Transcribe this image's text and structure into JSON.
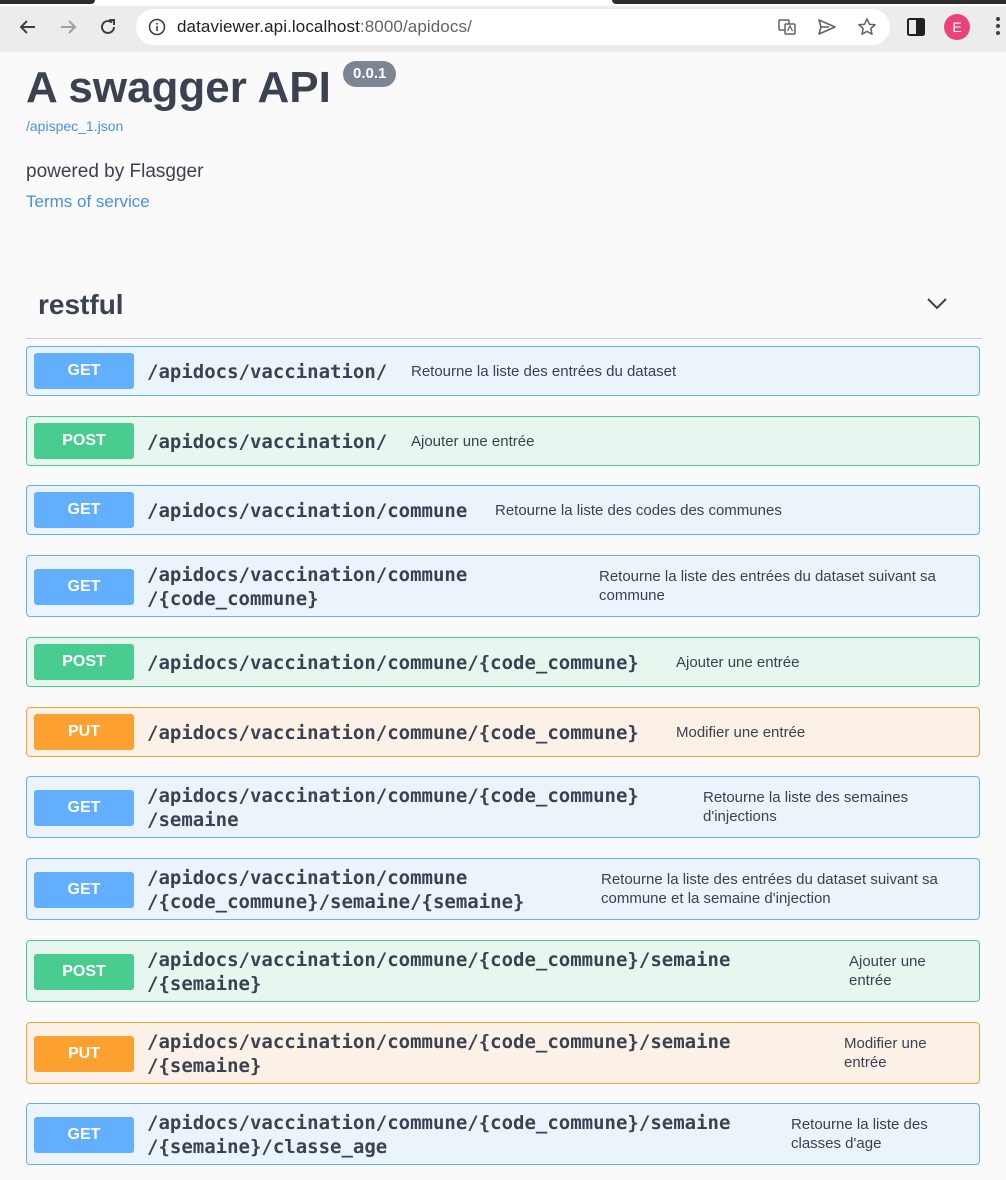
{
  "browser": {
    "url_host": "dataviewer.api.localhost",
    "url_rest": ":8000/apidocs/",
    "profile_initial": "E"
  },
  "info": {
    "title": "A swagger API",
    "version": "0.0.1",
    "spec_link": "/apispec_1.json",
    "description": "powered by Flasgger",
    "terms": "Terms of service"
  },
  "tag": {
    "name": "restful"
  },
  "operations": [
    {
      "method": "GET",
      "path_line1": "/apidocs/vaccination/",
      "path_line2": "",
      "summary": "Retourne la liste des entrées du dataset"
    },
    {
      "method": "POST",
      "path_line1": "/apidocs/vaccination/",
      "path_line2": "",
      "summary": "Ajouter une entrée"
    },
    {
      "method": "GET",
      "path_line1": "/apidocs/vaccination/commune",
      "path_line2": "",
      "summary": "Retourne la liste des codes des communes"
    },
    {
      "method": "GET",
      "path_line1": "/apidocs/vaccination/commune",
      "path_line2": "/{code_commune}",
      "summary": "Retourne la liste des entrées du dataset suivant sa commune"
    },
    {
      "method": "POST",
      "path_line1": "/apidocs/vaccination/commune/{code_commune}",
      "path_line2": "",
      "summary": "Ajouter une entrée"
    },
    {
      "method": "PUT",
      "path_line1": "/apidocs/vaccination/commune/{code_commune}",
      "path_line2": "",
      "summary": "Modifier une entrée"
    },
    {
      "method": "GET",
      "path_line1": "/apidocs/vaccination/commune/{code_commune}",
      "path_line2": "/semaine",
      "summary": "Retourne la liste des semaines d'injections"
    },
    {
      "method": "GET",
      "path_line1": "/apidocs/vaccination/commune",
      "path_line2": "/{code_commune}/semaine/{semaine}",
      "summary": "Retourne la liste des entrées du dataset suivant sa commune et la semaine d'injection"
    },
    {
      "method": "POST",
      "path_line1": "/apidocs/vaccination/commune/{code_commune}/semaine",
      "path_line2": "/{semaine}",
      "summary": "Ajouter une entrée"
    },
    {
      "method": "PUT",
      "path_line1": "/apidocs/vaccination/commune/{code_commune}/semaine",
      "path_line2": "/{semaine}",
      "summary": "Modifier une entrée"
    },
    {
      "method": "GET",
      "path_line1": "/apidocs/vaccination/commune/{code_commune}/semaine",
      "path_line2": "/{semaine}/classe_age",
      "summary": "Retourne la liste des classes d'age"
    }
  ]
}
